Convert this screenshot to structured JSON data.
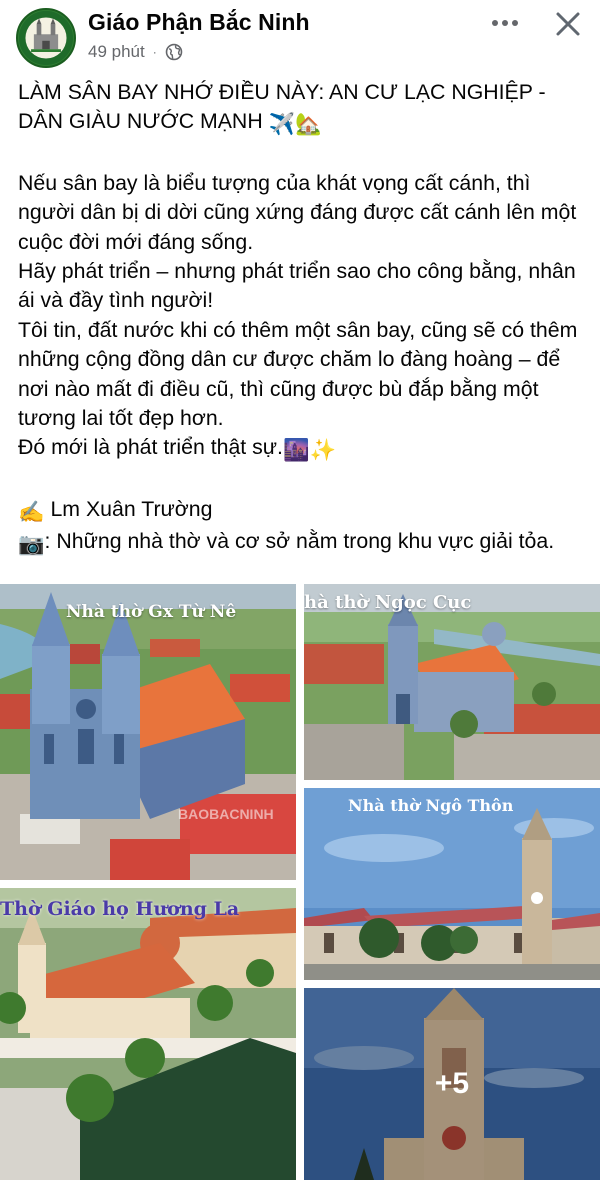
{
  "post": {
    "page_name": "Giáo Phận Bắc Ninh",
    "time": "49 phút",
    "separator": "·",
    "audience_icon": "globe-icon",
    "headline": "LÀM SÂN BAY NHỚ ĐIỀU NÀY: AN CƯ LẠC NGHIỆP - DÂN GIÀU NƯỚC MẠNH",
    "headline_emoji": "✈️🏡",
    "paragraph": "Nếu sân bay là biểu tượng của khát vọng cất cánh, thì người dân bị di dời cũng xứng đáng được cất cánh lên một cuộc đời mới đáng sống.\nHãy phát triển – nhưng phát triển sao cho công bằng, nhân ái và đầy tình người!\nTôi tin, đất nước khi có thêm một sân bay, cũng sẽ có thêm những cộng đồng dân cư được chăm lo đàng hoàng – để nơi nào mất đi điều cũ, thì cũng được bù đắp bằng một tương lai tốt đẹp hơn.\nĐó mới là phát triển thật sự.",
    "paragraph_emoji": "🌆✨",
    "author_emoji": "✍️",
    "author": " Lm Xuân Trường",
    "camera_emoji": "📷",
    "photo_note": ": Những nhà thờ và cơ sở nằm trong khu vực giải tỏa."
  },
  "photos": [
    {
      "caption": "Nhà thờ Gx Từ Nê",
      "watermark": "BAOBACNINH"
    },
    {
      "caption": "hà thờ Ngọc Cục"
    },
    {
      "caption": "Nhà thờ Ngô Thôn"
    },
    {
      "caption": "Thờ Giáo họ Hương La"
    },
    {
      "more_label": "+5"
    }
  ],
  "colors": {
    "text": "#050505",
    "meta": "#65676b",
    "caption_white": "#ffffff",
    "caption_purple": "#4a3aa8",
    "roof_orange": "#e8743c",
    "church_blue": "#6f8fb8"
  }
}
